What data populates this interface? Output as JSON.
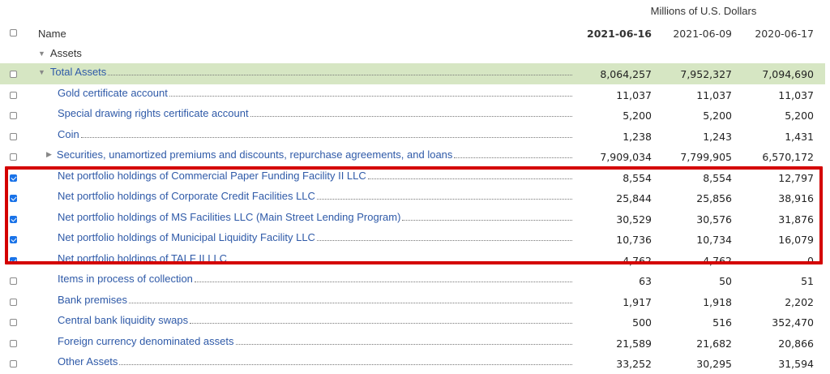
{
  "units_label": "Millions of U.S. Dollars",
  "header": {
    "name": "Name",
    "dates": [
      "2021-06-16",
      "2021-06-09",
      "2020-06-17"
    ]
  },
  "group_label": "Assets",
  "rows": [
    {
      "label": "Total Assets",
      "values": [
        "8,064,257",
        "7,952,327",
        "7,094,690"
      ],
      "checked": false,
      "indent": 1,
      "caret": "open"
    },
    {
      "label": "Gold certificate account",
      "values": [
        "11,037",
        "11,037",
        "11,037"
      ],
      "checked": false,
      "indent": 2
    },
    {
      "label": "Special drawing rights certificate account",
      "values": [
        "5,200",
        "5,200",
        "5,200"
      ],
      "checked": false,
      "indent": 2
    },
    {
      "label": "Coin",
      "values": [
        "1,238",
        "1,243",
        "1,431"
      ],
      "checked": false,
      "indent": 2
    },
    {
      "label": "Securities, unamortized premiums and discounts, repurchase agreements, and loans",
      "values": [
        "7,909,034",
        "7,799,905",
        "6,570,172"
      ],
      "checked": false,
      "indent": 2,
      "caret": "closed"
    },
    {
      "label": "Net portfolio holdings of Commercial Paper Funding Facility II LLC",
      "values": [
        "8,554",
        "8,554",
        "12,797"
      ],
      "checked": true,
      "indent": 2
    },
    {
      "label": "Net portfolio holdings of Corporate Credit Facilities LLC",
      "values": [
        "25,844",
        "25,856",
        "38,916"
      ],
      "checked": true,
      "indent": 2
    },
    {
      "label": "Net portfolio holdings of MS Facilities LLC (Main Street Lending Program)",
      "values": [
        "30,529",
        "30,576",
        "31,876"
      ],
      "checked": true,
      "indent": 2
    },
    {
      "label": "Net portfolio holdings of Municipal Liquidity Facility LLC",
      "values": [
        "10,736",
        "10,734",
        "16,079"
      ],
      "checked": true,
      "indent": 2
    },
    {
      "label": "Net portfolio holdings of TALF II LLC",
      "values": [
        "4,762",
        "4,762",
        "0"
      ],
      "checked": true,
      "indent": 2
    },
    {
      "label": "Items in process of collection",
      "values": [
        "63",
        "50",
        "51"
      ],
      "checked": false,
      "indent": 2
    },
    {
      "label": "Bank premises",
      "values": [
        "1,917",
        "1,918",
        "2,202"
      ],
      "checked": false,
      "indent": 2
    },
    {
      "label": "Central bank liquidity swaps",
      "values": [
        "500",
        "516",
        "352,470"
      ],
      "checked": false,
      "indent": 2
    },
    {
      "label": "Foreign currency denominated assets",
      "values": [
        "21,589",
        "21,682",
        "20,866"
      ],
      "checked": false,
      "indent": 2
    },
    {
      "label": "Other Assets",
      "values": [
        "33,252",
        "30,295",
        "31,594"
      ],
      "checked": false,
      "indent": 2
    }
  ]
}
